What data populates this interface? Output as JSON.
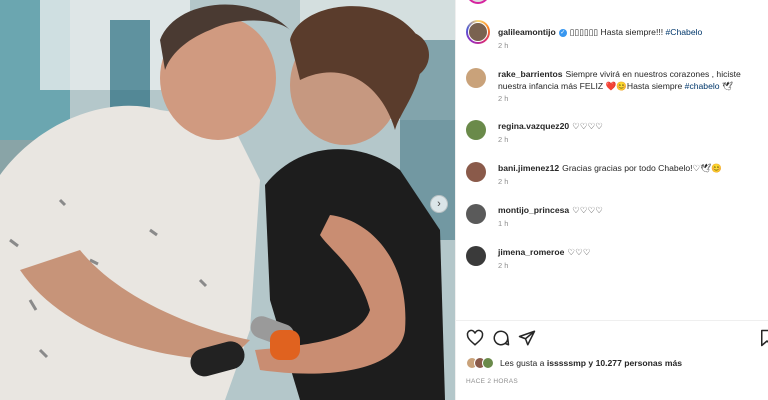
{
  "post": {
    "author": "galileamontijo",
    "caption": "▯▯▯▯▯▯ Hasta siempre!!! ",
    "hashtag": "#Chabelo",
    "time": "2 h"
  },
  "comments": [
    {
      "user": "rake_barrientos",
      "text": "Siempre vivirá en nuestros corazones , hiciste nuestra infancia más FELIZ ❤️😊Hasta siempre ",
      "tag": "#chabelo",
      "suffix": " 🕊",
      "time": "2 h",
      "avatar_color": "#c9a27a"
    },
    {
      "user": "regina.vazquez20",
      "text": "♡♡♡♡",
      "time": "2 h",
      "avatar_color": "#6a8a4a"
    },
    {
      "user": "bani.jimenez12",
      "text": "Gracias gracias por todo Chabelo!♡🕊😊",
      "time": "2 h",
      "avatar_color": "#8a5a4a"
    },
    {
      "user": "montijo_princesa",
      "text": "♡♡♡♡",
      "time": "1 h",
      "avatar_color": "#5a5a5a"
    },
    {
      "user": "jimena_romeroe",
      "text": "♡♡♡",
      "time": "2 h",
      "avatar_color": "#3a3a3a"
    }
  ],
  "likes": {
    "text": "Les gusta a ",
    "user": "isssssmp",
    "rest": " y 10.277 personas más"
  },
  "timestamp": "HACE 2 HORAS",
  "icons": {
    "like": "heart-icon",
    "comment": "comment-icon",
    "share": "send-icon",
    "save": "bookmark-icon",
    "next": "chevron-right-icon"
  },
  "colors": {
    "hashtag": "#00376b",
    "verified": "#3897f0",
    "muted": "#8e8e8e"
  }
}
